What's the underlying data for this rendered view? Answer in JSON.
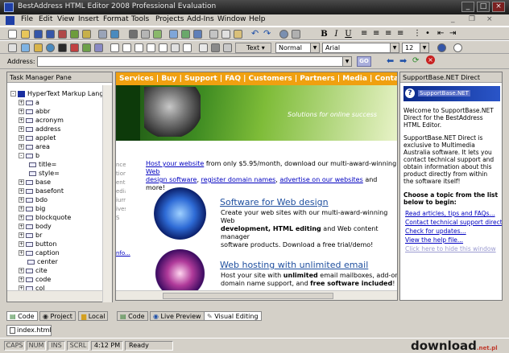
{
  "window": {
    "title": "BestAddress HTML Editor 2008 Professional Evaluation",
    "buttons": [
      "_",
      "□",
      "×"
    ]
  },
  "menu": [
    "File",
    "Edit",
    "View",
    "Insert",
    "Format",
    "Tools",
    "Projects",
    "Add-Ins",
    "Window",
    "Help"
  ],
  "toolbar": {
    "text_button": "Text",
    "style_combo": "Normal",
    "font_combo": "Arial",
    "size_combo": "12",
    "bold": "B",
    "italic": "I",
    "underline": "U"
  },
  "address": {
    "label": "Address:",
    "value": "",
    "go": "GO"
  },
  "task_pane": {
    "title": "Task Manager Pane",
    "root": "HyperText Markup Langu",
    "items": [
      "a",
      "abbr",
      "acronym",
      "address",
      "applet",
      "area",
      "b",
      "title=",
      "style=",
      "base",
      "basefont",
      "bdo",
      "big",
      "blockquote",
      "body",
      "br",
      "button",
      "caption",
      "center",
      "cite",
      "code",
      "col"
    ],
    "tabs": [
      "Code",
      "Project",
      "Local"
    ]
  },
  "editor": {
    "nav": "Services | Buy | Support | FAQ | Customers | Partners | Media | Conta",
    "banner_text": "Solutions for online success",
    "intro": {
      "link1": "Host your website",
      "text1": " from only $5.95/month, download our multi-award-winning ",
      "link2": "Web",
      "link3": "design software",
      "sep1": ", ",
      "link4": "register domain names",
      "sep2": ", ",
      "link5": "advertise on our websites",
      "text2": " and more!"
    },
    "left_fragments": [
      "nce",
      "tion",
      "ent",
      "edia",
      "iurry",
      "ives S"
    ],
    "left_link": "nfo...",
    "section1": {
      "title": "Software for Web design",
      "line1": "Create your web sites with our multi-award-winning Web",
      "line2a": "development, HTML editing",
      "line2b": " and Web content manager",
      "line3": "software products. Download a free trial/demo!"
    },
    "section2": {
      "title": "Web hosting with unlimited email",
      "line1a": "Host your site with ",
      "line1b": "unlimited",
      "line1c": " email mailboxes, add-on",
      "line2a": "domain name support, and ",
      "line2b": "free software included",
      "line2c": "!"
    },
    "tabs": [
      "Code",
      "Live Preview",
      "Visual Editing"
    ]
  },
  "support": {
    "title": "SupportBase.NET Direct",
    "logo": "SupportBase.NET",
    "welcome": "Welcome to SupportBase.NET Direct for the BestAddress HTML Editor.",
    "about": "SupportBase.NET Direct is exclusive to Multimedia Australia software. It lets you contact technical support and obtain information about this product directly from within the software itself!",
    "prompt": "Choose a topic from the list below to begin:",
    "links": [
      "Read articles, tips and FAQs...",
      "Contact technical support directly...",
      "Check for updates...",
      "View the help file..."
    ],
    "hide_link": "Click here to hide this window"
  },
  "document_tab": "index.html",
  "status": {
    "caps": "CAPS",
    "num": "NUM",
    "ins": "INS",
    "scrl": "SCRL",
    "time": "4:12 PM",
    "state": "Ready"
  },
  "watermark": {
    "text": "download",
    "suffix": ".net.pl"
  },
  "colors": {
    "nav_bg": "#f0a010",
    "link": "#0000c0",
    "heading_link": "#1f4f9f"
  }
}
